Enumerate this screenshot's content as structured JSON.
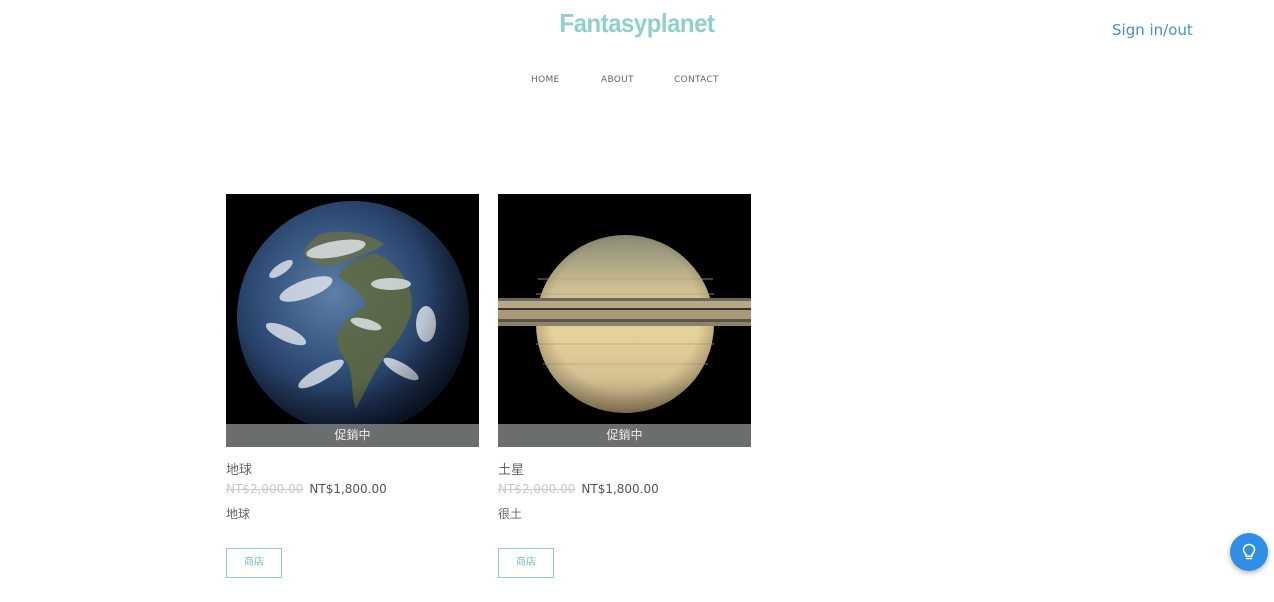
{
  "header": {
    "brand": "Fantasyplanet",
    "sign_link": "Sign in/out"
  },
  "nav": {
    "items": [
      "HOME",
      "ABOUT",
      "CONTACT"
    ]
  },
  "products": [
    {
      "name": "地球",
      "badge": "促銷中",
      "old_price": "NT$2,000.00",
      "price": "NT$1,800.00",
      "description": "地球",
      "button": "商店",
      "image_icon": "earth-image"
    },
    {
      "name": "土星",
      "badge": "促銷中",
      "old_price": "NT$2,000.00",
      "price": "NT$1,800.00",
      "description": "很土",
      "button": "商店",
      "image_icon": "saturn-image"
    }
  ],
  "colors": {
    "brand": "#8fcfce",
    "link": "#4a8fc4",
    "help_button": "#2f8fe6",
    "shop_border": "#8fd0cd"
  },
  "floating": {
    "help_icon": "lightbulb-icon"
  }
}
